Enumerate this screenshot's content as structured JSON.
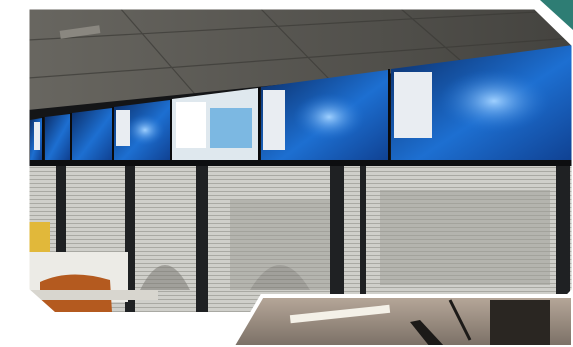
{
  "scene": {
    "colors": {
      "background": "#ffffff",
      "accent": "#2e7d74",
      "ceiling": "#5d5b55",
      "window_frame": "#1f2123",
      "blinds": "#c9c9c3",
      "screen_blue": "#1d6fd1",
      "screen_dark": "#0b2d67",
      "panel_window": "#e9edf2"
    },
    "screens": [
      {
        "label": "",
        "has_window": true
      },
      {
        "label": "",
        "has_window": true
      },
      {
        "label": "",
        "has_window": true
      },
      {
        "label": "",
        "has_window": true
      },
      {
        "label": "",
        "has_window": false
      },
      {
        "label": "",
        "has_window": true
      },
      {
        "label": "",
        "has_window": true
      }
    ]
  }
}
